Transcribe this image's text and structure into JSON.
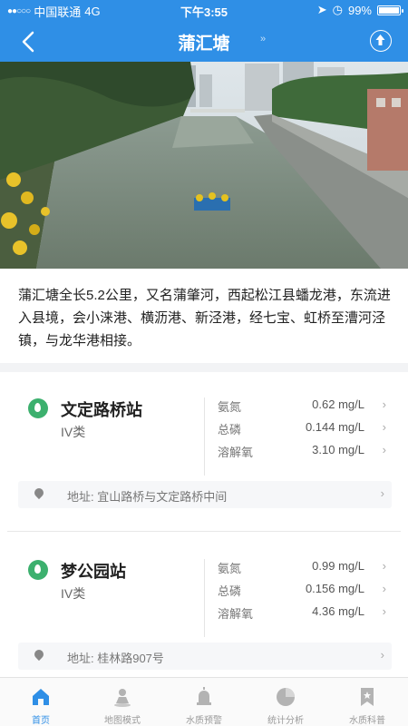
{
  "status_bar": {
    "carrier": "中国联通",
    "network": "4G",
    "time": "下午3:55",
    "battery": "99%"
  },
  "header": {
    "title": "蒲汇塘",
    "title_hint": "»"
  },
  "description": "蒲汇塘全长5.2公里，又名蒲肇河，西起松江县蟠龙港，东流进入县境，会小涞港、横沥港、新泾港，经七宝、虹桥至漕河泾镇，与龙华港相接。",
  "stations": [
    {
      "name": "文定路桥站",
      "class": "IV类",
      "measurements": [
        {
          "label": "氨氮",
          "value": "0.62 mg/L"
        },
        {
          "label": "总磷",
          "value": "0.144 mg/L"
        },
        {
          "label": "溶解氧",
          "value": "3.10 mg/L"
        }
      ],
      "address": "地址: 宜山路桥与文定路桥中间"
    },
    {
      "name": "梦公园站",
      "class": "IV类",
      "measurements": [
        {
          "label": "氨氮",
          "value": "0.99 mg/L"
        },
        {
          "label": "总磷",
          "value": "0.156 mg/L"
        },
        {
          "label": "溶解氧",
          "value": "4.36 mg/L"
        }
      ],
      "address": "地址: 桂林路907号"
    }
  ],
  "tabs": [
    {
      "label": "首页",
      "icon": "home-icon"
    },
    {
      "label": "地图模式",
      "icon": "map-person-icon"
    },
    {
      "label": "水质预警",
      "icon": "alarm-icon"
    },
    {
      "label": "统计分析",
      "icon": "pie-chart-icon"
    },
    {
      "label": "水质科普",
      "icon": "bookmark-icon"
    }
  ],
  "colors": {
    "header": "#2f8fe6",
    "station_icon": "#3cb06e",
    "tab_active": "#2f8fe6",
    "tab_inactive": "#9a9a9a"
  }
}
